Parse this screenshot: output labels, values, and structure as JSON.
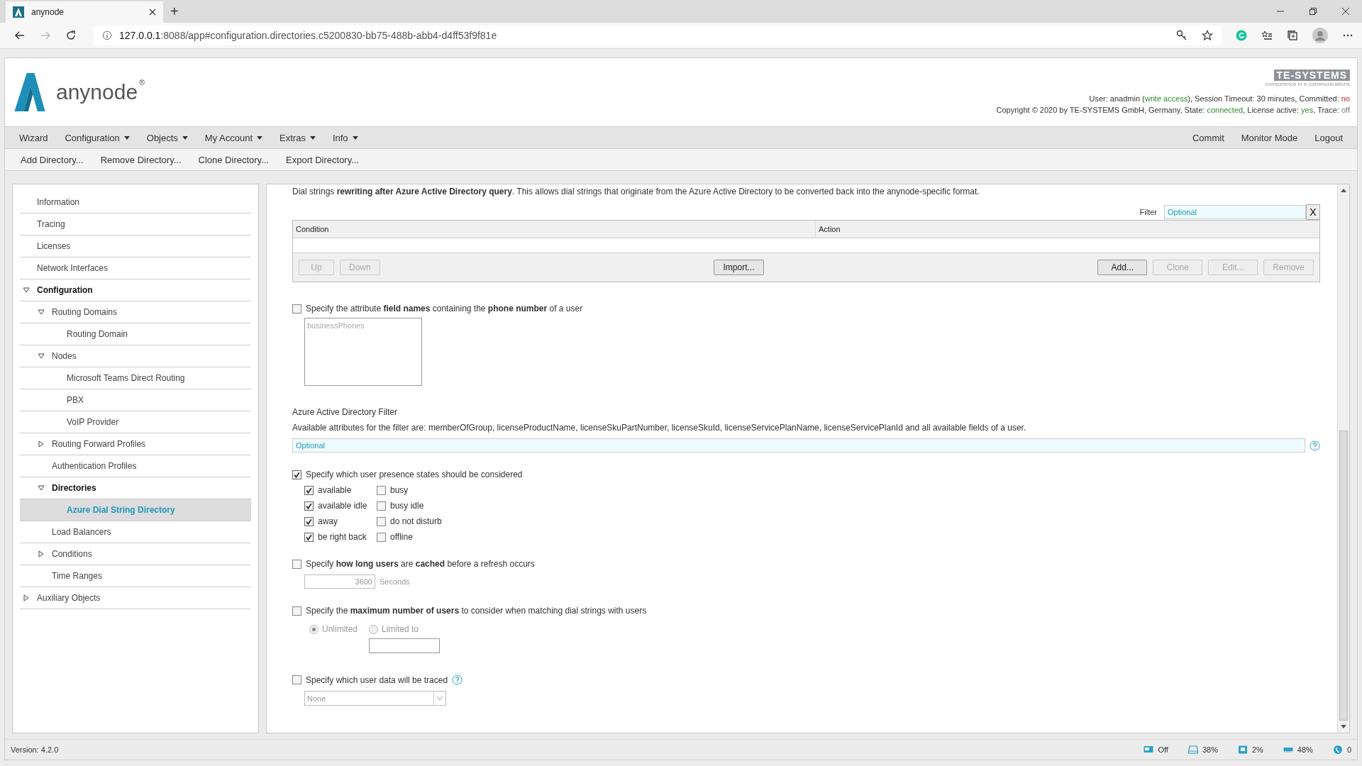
{
  "browser": {
    "tab": {
      "title": "anynode"
    },
    "new_tab": "+",
    "address": {
      "host": "127.0.0.1",
      "path": ":8088/app#configuration.directories.c5200830-bb75-488b-abb4-d4ff53f9f81e"
    }
  },
  "header": {
    "product": "anynode",
    "product_mark": "®",
    "vendor": "TE-SYSTEMS",
    "vendor_tagline": "competence in e-communications",
    "info_lines": [
      [
        {
          "text": "User: anadmin (",
          "kind": "plain"
        },
        {
          "text": "write access",
          "kind": "positive"
        },
        {
          "text": "), Session Timeout: 30 minutes, Committed: ",
          "kind": "plain"
        },
        {
          "text": "no",
          "kind": "negative"
        }
      ],
      [
        {
          "text": "Copyright © 2020 by TE-SYSTEMS GmbH, Germany, State: ",
          "kind": "plain"
        },
        {
          "text": "connected",
          "kind": "positive"
        },
        {
          "text": ", License active: ",
          "kind": "plain"
        },
        {
          "text": "yes",
          "kind": "positive"
        },
        {
          "text": ", Trace: ",
          "kind": "plain"
        },
        {
          "text": "off",
          "kind": "neutral"
        }
      ]
    ]
  },
  "menu": {
    "left": [
      {
        "label": "Wizard",
        "dropdown": false
      },
      {
        "label": "Configuration",
        "dropdown": true
      },
      {
        "label": "Objects",
        "dropdown": true
      },
      {
        "label": "My Account",
        "dropdown": true
      },
      {
        "label": "Extras",
        "dropdown": true
      },
      {
        "label": "Info",
        "dropdown": true
      }
    ],
    "right": [
      "Commit",
      "Monitor Mode",
      "Logout"
    ]
  },
  "toolbar": [
    "Add Directory...",
    "Remove Directory...",
    "Clone Directory...",
    "Export Directory..."
  ],
  "sidebar": {
    "items": [
      {
        "label": "Information",
        "selected": false
      },
      {
        "label": "Tracing",
        "selected": false
      },
      {
        "label": "Licenses",
        "selected": false
      },
      {
        "label": "Network Interfaces",
        "selected": false
      },
      {
        "label": "Configuration",
        "selected": false,
        "expanded": true,
        "children": [
          {
            "label": "Routing Domains",
            "selected": false,
            "expanded": true,
            "children": [
              {
                "label": "Routing Domain",
                "selected": false
              }
            ]
          },
          {
            "label": "Nodes",
            "selected": false,
            "expanded": true,
            "children": [
              {
                "label": "Microsoft Teams Direct Routing",
                "selected": false
              },
              {
                "label": "PBX",
                "selected": false
              },
              {
                "label": "VoIP Provider",
                "selected": false
              }
            ]
          },
          {
            "label": "Routing Forward Profiles",
            "selected": false,
            "expanded": false
          },
          {
            "label": "Authentication Profiles",
            "selected": false
          },
          {
            "label": "Directories",
            "selected": false,
            "expanded": true,
            "children": [
              {
                "label": "Azure Dial String Directory",
                "selected": true
              }
            ]
          },
          {
            "label": "Load Balancers",
            "selected": false
          },
          {
            "label": "Conditions",
            "selected": false,
            "expanded": false
          },
          {
            "label": "Time Ranges",
            "selected": false
          }
        ]
      },
      {
        "label": "Auxiliary Objects",
        "selected": false,
        "expanded": false
      }
    ]
  },
  "rewriting": {
    "description": "Dial strings **rewriting after Azure Active Directory query**. This allows dial strings that originate from the Azure Active Directory to be converted back into the anynode-specific format.",
    "filter_label": "Filter",
    "filter": {
      "placeholder": "Optional"
    },
    "clear_button": "X",
    "table": {
      "columns": [
        "Condition",
        "Action"
      ]
    },
    "button_groups": [
      [
        {
          "label": "Up",
          "disabled": true
        },
        {
          "label": "Down",
          "disabled": true
        }
      ],
      [
        {
          "label": "Import...",
          "disabled": false
        }
      ],
      [
        {
          "label": "Add...",
          "disabled": false
        },
        {
          "label": "Clone",
          "disabled": true
        },
        {
          "label": "Edit...",
          "disabled": true
        },
        {
          "label": "Remove",
          "disabled": true
        }
      ]
    ]
  },
  "field_names": {
    "label": "Specify the attribute **field names** containing the **phone number** of a user",
    "checked": false,
    "values": [
      "businessPhones"
    ]
  },
  "aad_filter": {
    "title": "Azure Active Directory Filter",
    "description": "Available attributes for the filter are: memberOfGroup, licenseProductName, licenseSkuPartNumber, licenseSkuId, licenseServicePlanName, licenseServicePlanId and all available fields of a user.",
    "field": {
      "placeholder": "Optional"
    }
  },
  "presence": {
    "label": "Specify which user presence states should be considered",
    "checked": true,
    "states": [
      {
        "label": "available",
        "checked": true
      },
      {
        "label": "busy",
        "checked": false
      },
      {
        "label": "available idle",
        "checked": true
      },
      {
        "label": "busy idle",
        "checked": false
      },
      {
        "label": "away",
        "checked": true
      },
      {
        "label": "do not disturb",
        "checked": false
      },
      {
        "label": "be right back",
        "checked": true
      },
      {
        "label": "offline",
        "checked": false
      }
    ]
  },
  "cache": {
    "label": "Specify **how long users** are **cached** before a refresh occurs",
    "checked": false,
    "value": "3600",
    "unit": "Seconds"
  },
  "max_users": {
    "label": "Specify the **maximum number of users** to consider when matching dial strings with users",
    "checked": false,
    "options": [
      {
        "label": "Unlimited",
        "selected": true
      },
      {
        "label": "Limited to",
        "selected": false
      }
    ]
  },
  "trace_data": {
    "label": "Specify which user data will be traced",
    "checked": false,
    "value": "None"
  },
  "status_bar": {
    "version": "Version: 4.2.0",
    "indicators": [
      {
        "kind": "recording",
        "text": "Off"
      },
      {
        "kind": "disk",
        "text": "38%"
      },
      {
        "kind": "cpu",
        "text": "2%"
      },
      {
        "kind": "memory",
        "text": "48%"
      },
      {
        "kind": "calls",
        "text": "0"
      }
    ]
  }
}
